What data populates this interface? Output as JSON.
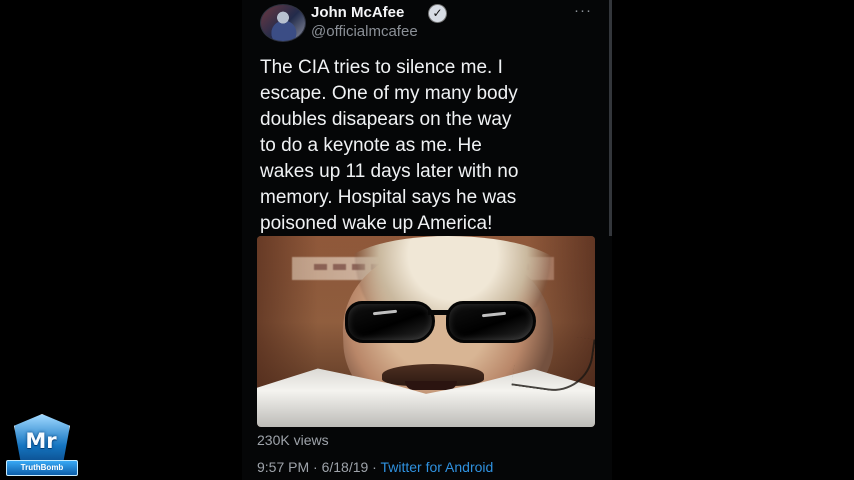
{
  "tweet": {
    "author": {
      "display_name": "John McAfee",
      "handle": "@officialmcafee",
      "avatar_icon": "profile-avatar",
      "verified_icon": "verified-check-icon"
    },
    "text": "The CIA tries to silence me. I\nescape. One of my many body\ndoubles disapears on the way\nto do a keynote as me. He\nwakes up 11 days later with no\nmemory. Hospital says he was\npoisoned  wake up America!",
    "media": {
      "type": "video-thumbnail",
      "icon": "video-thumbnail-image"
    },
    "views": "230K views",
    "timestamp": "9:57 PM · 6/18/19 · ",
    "source": "Twitter for Android",
    "more_icon": "more-options-icon"
  },
  "watermark": {
    "title": "Mr",
    "subtitle": "TruthBomb",
    "icon": "mr-truthbomb-badge"
  },
  "colors": {
    "background": "#000000",
    "text_primary": "#f0f2f4",
    "text_secondary": "#9ea3aa",
    "link": "#2f91df"
  }
}
